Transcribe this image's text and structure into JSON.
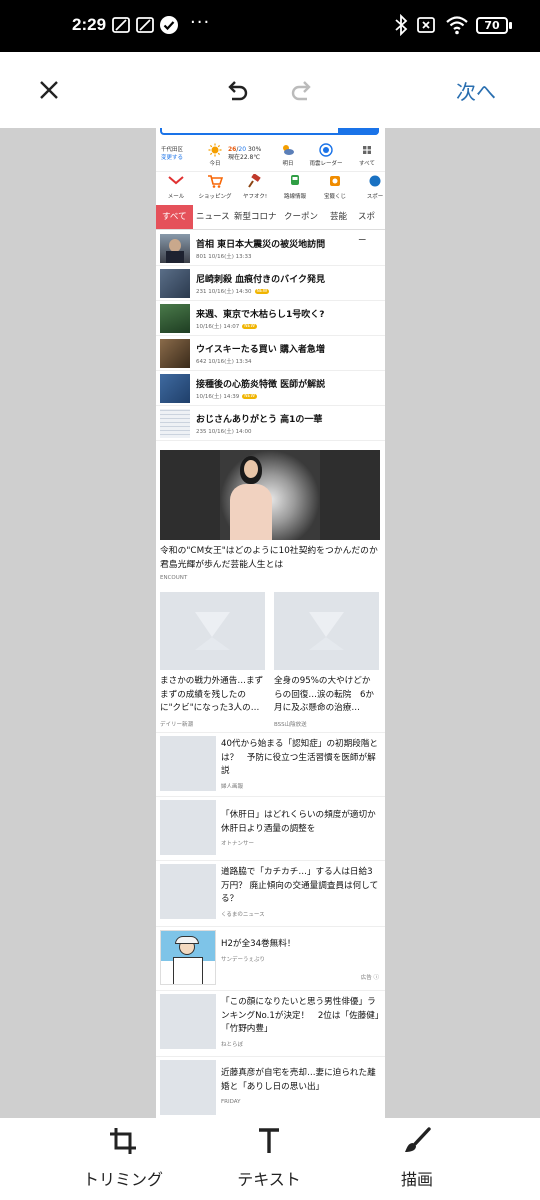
{
  "status_bar": {
    "time": "2:29",
    "dots": "···",
    "battery": "70"
  },
  "toolbar": {
    "next_label": "次へ"
  },
  "screenshot": {
    "weather": {
      "location": "千代田区",
      "change_location": "変更する",
      "today_label": "今日",
      "temp_high": "26",
      "temp_low": "20",
      "rain_chance": "30%",
      "current_temp": "現在22.8℃",
      "tomorrow_label": "明日",
      "radar_label": "雨雲レーダー",
      "all_label": "すべて"
    },
    "services": [
      "メール",
      "ショッピング",
      "ヤフオク!",
      "路線情報",
      "宝籤くじ",
      "スポー"
    ],
    "tabs": [
      "すべて",
      "ニュース",
      "新型コロナ",
      "クーポン",
      "芸能",
      "スポー"
    ],
    "news": [
      {
        "title": "首相 東日本大震災の被災地訪問",
        "meta": "801  10/16(土) 13:33",
        "new": false
      },
      {
        "title": "尼崎刺殺 血痕付きのバイク発見",
        "meta": "231  10/16(土) 14:30",
        "new": true
      },
      {
        "title": "来週、東京で木枯らし1号吹く?",
        "meta": "10/16(土) 14:07",
        "new": true
      },
      {
        "title": "ウイスキーたる買い 購入者急増",
        "meta": "642  10/16(土) 13:34",
        "new": false
      },
      {
        "title": "接種後の心筋炎特徴 医師が解説",
        "meta": "10/16(土) 14:39",
        "new": true
      },
      {
        "title": "おじさんありがとう 高1の一華",
        "meta": "235  10/16(土) 14:00",
        "new": false
      }
    ],
    "new_badge": "NEW",
    "hero": {
      "title": "令和の\"CM女王\"はどのように10社契約をつかんだのか　君島光輝が歩んだ芸能人生とは",
      "source": "ENCOUNT"
    },
    "cards": [
      {
        "title": "まさかの戦力外通告…まずまずの成績を残したのに\"クビ\"になった3人の…",
        "source": "デイリー新潮"
      },
      {
        "title": "全身の95%の大やけどからの回復…涙の転院　6か月に及ぶ懸命の治療…",
        "source": "BSS山陰放送"
      }
    ],
    "list": [
      {
        "title": "40代から始まる「認知症」の初期段階とは？　予防に役立つ生活習慣を医師が解説",
        "source": "婦人画報"
      },
      {
        "title": "「休肝日」はどれくらいの頻度が適切か　休肝日より酒量の調整を",
        "source": "オトナンサー"
      },
      {
        "title": "道路脇で「カチカチ…」する人は日給3万円？ 廃止傾向の交通量調査員は何してる？",
        "source": "くるまのニュース"
      },
      {
        "title": "H2が全34巻無料！",
        "source": "サンデーうぇぶり"
      },
      {
        "title": "「この顔になりたいと思う男性俳優」ランキングNo.1が決定！　2位は「佐藤健」「竹野内豊」",
        "source": "ねとらぼ"
      },
      {
        "title": "近藤真彦が自宅を売却…妻に迫られた離婚と「ありし日の思い出」",
        "source": "FRIDAY"
      }
    ],
    "ad_label": "広告 ⓘ"
  },
  "bottom_bar": {
    "crop_label": "トリミング",
    "text_label": "テキスト",
    "draw_label": "描画"
  },
  "colors": {
    "accent": "#2a6fb0",
    "tab_active": "#e5515a",
    "search_blue": "#1a73e8"
  }
}
